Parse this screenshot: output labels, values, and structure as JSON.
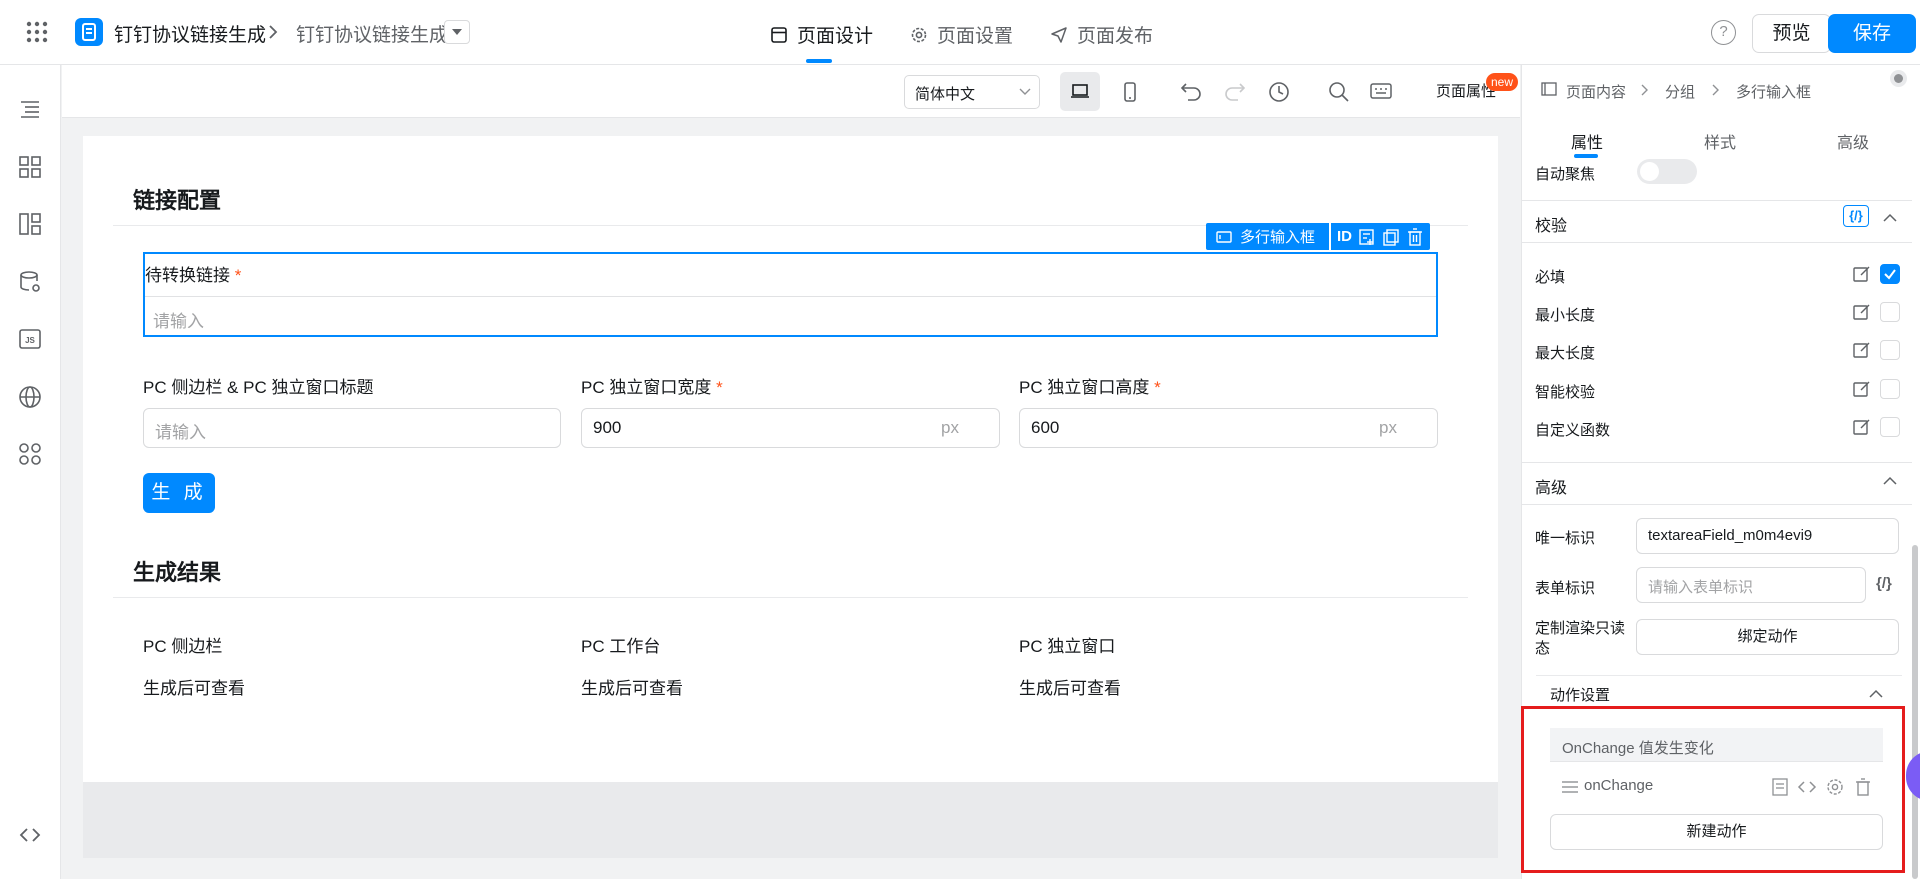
{
  "app": {
    "title": "钉钉协议链接生成",
    "subtitle": "钉钉协议链接生成"
  },
  "top_tabs": [
    {
      "label": "页面设计",
      "active": true,
      "icon": "layout-icon"
    },
    {
      "label": "页面设置",
      "active": false,
      "icon": "gear-icon"
    },
    {
      "label": "页面发布",
      "active": false,
      "icon": "send-icon"
    }
  ],
  "top_actions": {
    "help": "?",
    "preview": "预览",
    "save": "保存"
  },
  "toolbar": {
    "language": "简体中文",
    "page_props": "页面属性",
    "new_badge": "new"
  },
  "form": {
    "section1_title": "链接配置",
    "selected_component": {
      "type_label": "多行输入框",
      "id_label": "ID"
    },
    "link_label": "待转换链接",
    "link_required": "*",
    "link_placeholder": "请输入",
    "title_label": "PC 侧边栏 & PC 独立窗口标题",
    "title_placeholder": "请输入",
    "width_label": "PC 独立窗口宽度",
    "width_required": "*",
    "width_value": "900",
    "width_unit": "px",
    "height_label": "PC 独立窗口高度",
    "height_required": "*",
    "height_value": "600",
    "height_unit": "px",
    "generate_button": "生 成",
    "section2_title": "生成结果",
    "results": [
      {
        "label": "PC 侧边栏",
        "value": "生成后可查看"
      },
      {
        "label": "PC 工作台",
        "value": "生成后可查看"
      },
      {
        "label": "PC 独立窗口",
        "value": "生成后可查看"
      }
    ]
  },
  "right_panel": {
    "breadcrumb": [
      "页面内容",
      "分组",
      "多行输入框"
    ],
    "tabs": [
      "属性",
      "样式",
      "高级"
    ],
    "auto_focus_label": "自动聚焦",
    "validation": {
      "title": "校验",
      "fx": "{/}",
      "items": [
        {
          "label": "必填",
          "checked": true
        },
        {
          "label": "最小长度",
          "checked": false
        },
        {
          "label": "最大长度",
          "checked": false
        },
        {
          "label": "智能校验",
          "checked": false
        },
        {
          "label": "自定义函数",
          "checked": false
        }
      ]
    },
    "advanced": {
      "title": "高级",
      "unique_id_label": "唯一标识",
      "unique_id_value": "textareaField_m0m4evi9",
      "form_id_label": "表单标识",
      "form_id_placeholder": "请输入表单标识",
      "fx": "{/}",
      "custom_render_label": "定制渲染只读态",
      "bind_action": "绑定动作"
    },
    "actions": {
      "title": "动作设置",
      "event_header": "OnChange 值发生变化",
      "event_name": "onChange",
      "new_action": "新建动作"
    }
  },
  "colors": {
    "primary": "#0089ff",
    "required": "#ff5219",
    "highlight": "#e51c1c"
  }
}
